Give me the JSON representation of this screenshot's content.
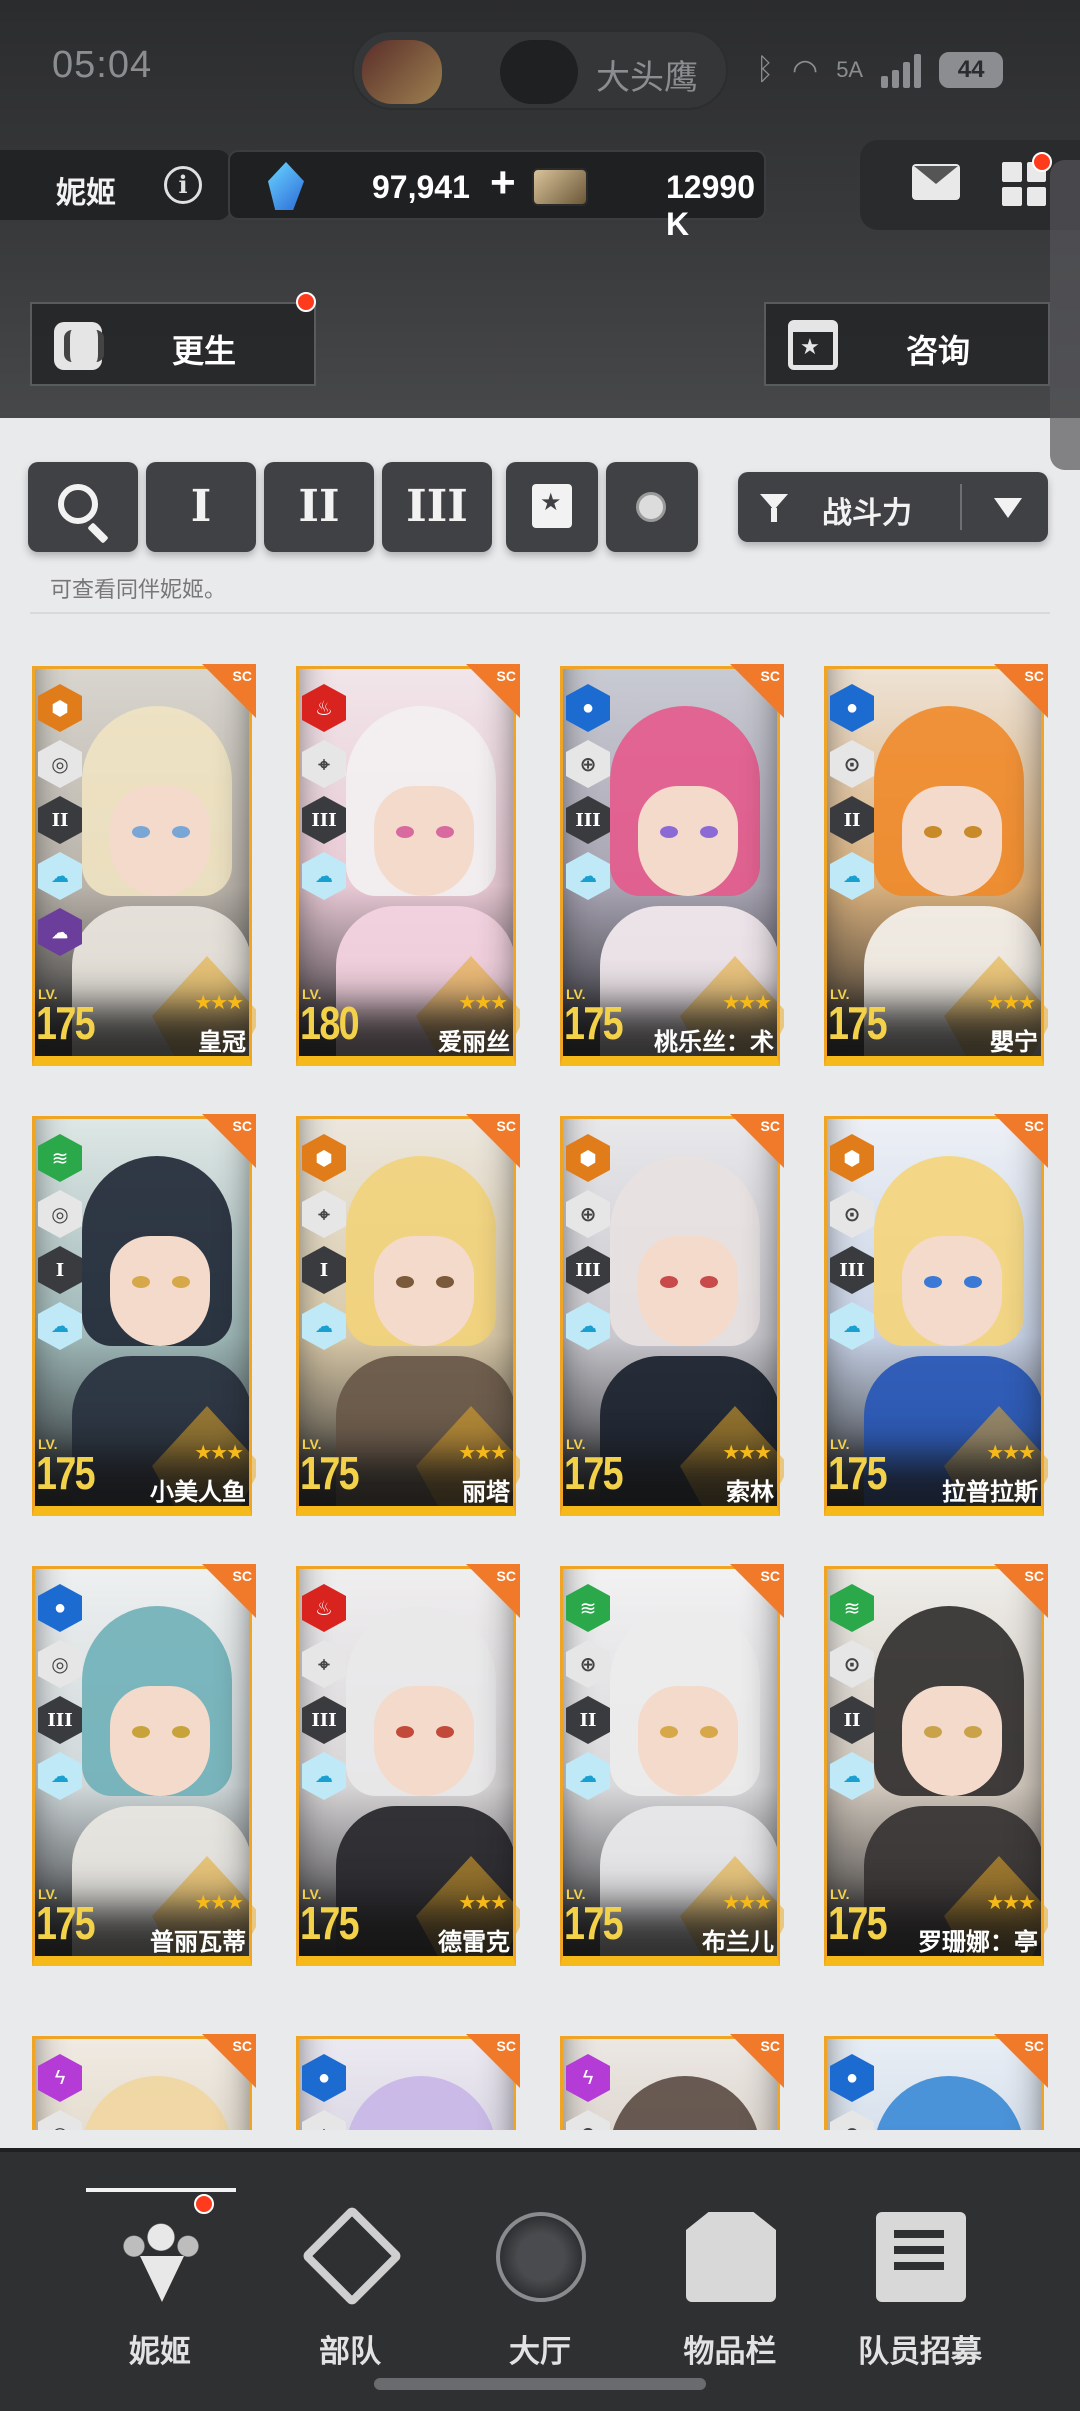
{
  "status": {
    "time": "05:04",
    "app_pill_text": "大头鹰",
    "network": "5A",
    "battery": "44"
  },
  "header": {
    "title": "妮姬",
    "gems": "97,941",
    "plus": "+",
    "credits": "12990 K"
  },
  "actions": {
    "reborn": "更生",
    "consult": "咨询"
  },
  "filters": {
    "class_1": "I",
    "class_2": "II",
    "class_3": "III",
    "sort_label": "战斗力"
  },
  "hint": "可查看同伴妮姬。",
  "nikkes": [
    {
      "name": "皇冠",
      "level": "175",
      "element": "iron",
      "burst": "II"
    },
    {
      "name": "爱丽丝",
      "level": "180",
      "element": "fire",
      "burst": "III"
    },
    {
      "name": "桃乐丝：术",
      "level": "175",
      "element": "water",
      "burst": "III"
    },
    {
      "name": "嬰宁",
      "level": "175",
      "element": "water",
      "burst": "II"
    },
    {
      "name": "小美人鱼",
      "level": "175",
      "element": "wind",
      "burst": "I"
    },
    {
      "name": "丽塔",
      "level": "175",
      "element": "iron",
      "burst": "I"
    },
    {
      "name": "索林",
      "level": "175",
      "element": "iron",
      "burst": "III"
    },
    {
      "name": "拉普拉斯",
      "level": "175",
      "element": "iron",
      "burst": "III"
    },
    {
      "name": "普丽瓦蒂",
      "level": "175",
      "element": "water",
      "burst": "III"
    },
    {
      "name": "德雷克",
      "level": "175",
      "element": "fire",
      "burst": "III"
    },
    {
      "name": "布兰儿",
      "level": "175",
      "element": "wind",
      "burst": "II"
    },
    {
      "name": "罗珊娜：亭",
      "level": "175",
      "element": "wind",
      "burst": "II"
    },
    {
      "name": "",
      "level": "",
      "element": "electric",
      "burst": ""
    },
    {
      "name": "",
      "level": "",
      "element": "water",
      "burst": ""
    },
    {
      "name": "",
      "level": "",
      "element": "electric",
      "burst": ""
    },
    {
      "name": "",
      "level": "",
      "element": "water",
      "burst": ""
    }
  ],
  "card_common": {
    "lv_label": "LV.",
    "stars": "★★★",
    "sc": "SC"
  },
  "nav": [
    {
      "label": "妮姬",
      "icon": "nikke-icon"
    },
    {
      "label": "部队",
      "icon": "squad-icon"
    },
    {
      "label": "大厅",
      "icon": "lobby-icon"
    },
    {
      "label": "物品栏",
      "icon": "inventory-icon"
    },
    {
      "label": "队员招募",
      "icon": "recruit-icon"
    }
  ],
  "colors": {
    "accent": "#f6b91a",
    "frame": "#f0a423",
    "badge": "#ff3b1e"
  }
}
